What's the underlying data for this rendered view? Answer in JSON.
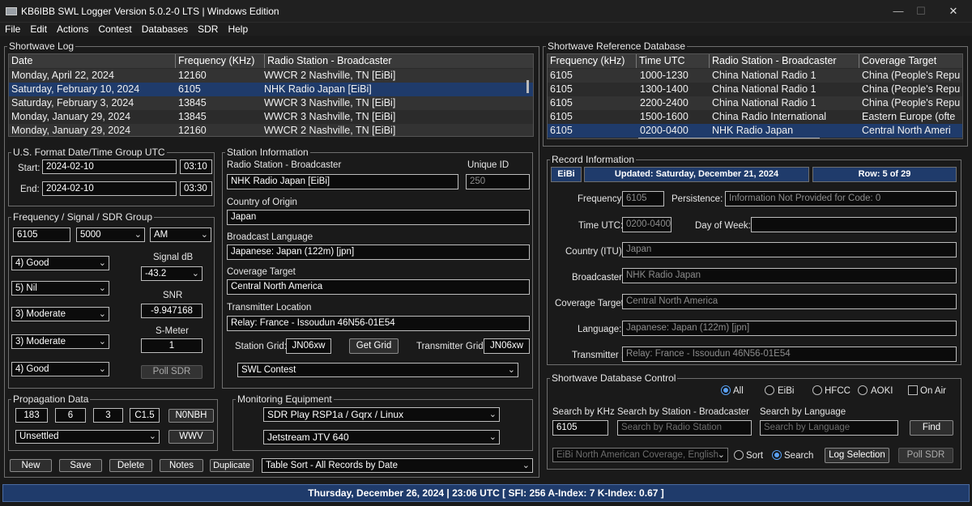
{
  "window": {
    "title": "KB6IBB SWL Logger Version  5.0.2-0 LTS  |  Windows Edition"
  },
  "menu": [
    "File",
    "Edit",
    "Actions",
    "Contest",
    "Databases",
    "SDR",
    "Help"
  ],
  "log": {
    "title": "Shortwave Log",
    "columns": [
      "Date",
      "Frequency (KHz)",
      "Radio Station - Broadcaster"
    ],
    "rows": [
      [
        "Monday, April 22, 2024",
        "12160",
        "WWCR 2 Nashville, TN  [EiBi]"
      ],
      [
        "Saturday, February 10, 2024",
        "6105",
        "NHK Radio Japan  [EiBi]"
      ],
      [
        "Saturday, February 3, 2024",
        "13845",
        "WWCR 3 Nashville, TN  [EiBi]"
      ],
      [
        "Monday, January 29, 2024",
        "13845",
        "WWCR 3 Nashville, TN  [EiBi]"
      ],
      [
        "Monday, January 29, 2024",
        "12160",
        "WWCR 2 Nashville, TN  [EiBi]"
      ]
    ]
  },
  "dtg": {
    "title": "U.S. Format Date/Time Group UTC",
    "start_label": "Start:",
    "start_date": "2024-02-10",
    "start_time": "03:10",
    "end_label": "End:",
    "end_date": "2024-02-10",
    "end_time": "03:30"
  },
  "freq": {
    "title": "Frequency / Signal / SDR Group",
    "frequency": "6105",
    "bandwidth": "5000",
    "mode": "AM",
    "r1": "4) Good",
    "r2": "5) Nil",
    "r3": "3) Moderate",
    "r4": "3) Moderate",
    "r5": "4) Good",
    "signal_label": "Signal dB",
    "signal": "-43.2",
    "snr_label": "SNR",
    "snr": "-9.947168",
    "smeter_label": "S-Meter",
    "smeter": "1",
    "poll": "Poll SDR"
  },
  "station": {
    "title": "Station Information",
    "broadcaster_label": "Radio Station - Broadcaster",
    "broadcaster": "NHK Radio Japan  [EiBi]",
    "uid_label": "Unique  ID",
    "uid": "250",
    "country_label": "Country of Origin",
    "country": "Japan",
    "language_label": "Broadcast Language",
    "language": "Japanese: Japan (122m)  [jpn]",
    "coverage_label": "Coverage Target",
    "coverage": "Central North America",
    "tx_label": "Transmitter Location",
    "tx": "Relay: France - Issoudun 46N56-01E54",
    "grid_label": "Station Grid:",
    "grid": "JN06xw",
    "get_grid": "Get Grid",
    "txgrid_label": "Transmitter Grid:",
    "txgrid": "JN06xw",
    "contest": "SWL Contest"
  },
  "prop": {
    "title": "Propagation Data",
    "v1": "183",
    "v2": "6",
    "v3": "3",
    "v4": "C1.5",
    "call": "N0NBH",
    "cond": "Unsettled",
    "wwv": "WWV"
  },
  "monitor": {
    "title": "Monitoring Equipment",
    "receiver": "SDR Play RSP1a / Gqrx / Linux",
    "antenna": "Jetstream JTV 640"
  },
  "actions": {
    "new": "New",
    "save": "Save",
    "delete": "Delete",
    "notes": "Notes",
    "duplicate": "Duplicate",
    "sort": "Table Sort - All Records by Date"
  },
  "ref": {
    "title": "Shortwave Reference Database",
    "columns": [
      "Frequency (kHz)",
      "Time UTC",
      "Radio Station - Broadcaster",
      "Coverage Target"
    ],
    "rows": [
      [
        "6105",
        "1000-1230",
        "China National Radio 1",
        "China (People's Repu"
      ],
      [
        "6105",
        "1300-1400",
        "China National Radio 1",
        "China (People's Repu"
      ],
      [
        "6105",
        "2200-2400",
        "China National Radio 1",
        "China (People's Repu"
      ],
      [
        "6105",
        "1500-1600",
        "China Radio International",
        "Eastern Europe (ofte"
      ],
      [
        "6105",
        "0200-0400",
        "NHK Radio Japan",
        "Central North Ameri"
      ]
    ]
  },
  "record": {
    "title": "Record Information",
    "source": "EiBi",
    "updated": "Updated: Saturday, December 21, 2024",
    "row": "Row: 5 of 29",
    "freq_label": "Frequency:",
    "freq": "6105",
    "persist_label": "Persistence:",
    "persist": "Information Not Provided for Code: 0",
    "time_label": "Time UTC:",
    "time": "0200-0400",
    "dow_label": "Day of Week:",
    "dow": "",
    "country_label": "Country (ITU):",
    "country": "Japan",
    "broadcaster_label": "Broadcaster:",
    "broadcaster": "NHK Radio Japan",
    "coverage_label": "Coverage Target:",
    "coverage": "Central North America",
    "language_label": "Language:",
    "language": "Japanese: Japan (122m)  [jpn]",
    "tx_label": "Transmitter :",
    "tx": "Relay: France - Issoudun 46N56-01E54"
  },
  "dbctl": {
    "title": "Shortwave Database Control",
    "all": "All",
    "eibi": "EiBi",
    "hfcc": "HFCC",
    "aoki": "AOKI",
    "onair": "On Air",
    "khz_label": "Search by KHz",
    "khz": "6105",
    "station_label": "Search by Station - Broadcaster",
    "station_ph": "Search by Radio Station",
    "lang_label": "Search by Language",
    "lang_ph": "Search by Language",
    "find": "Find",
    "filter": "EiBi North American Coverage, English",
    "sort": "Sort",
    "search": "Search",
    "log_sel": "Log Selection",
    "poll": "Poll SDR"
  },
  "status": "Thursday, December 26, 2024 | 23:06  UTC   [ SFI:  256  A-Index:  7  K-Index:  0.67 ]"
}
